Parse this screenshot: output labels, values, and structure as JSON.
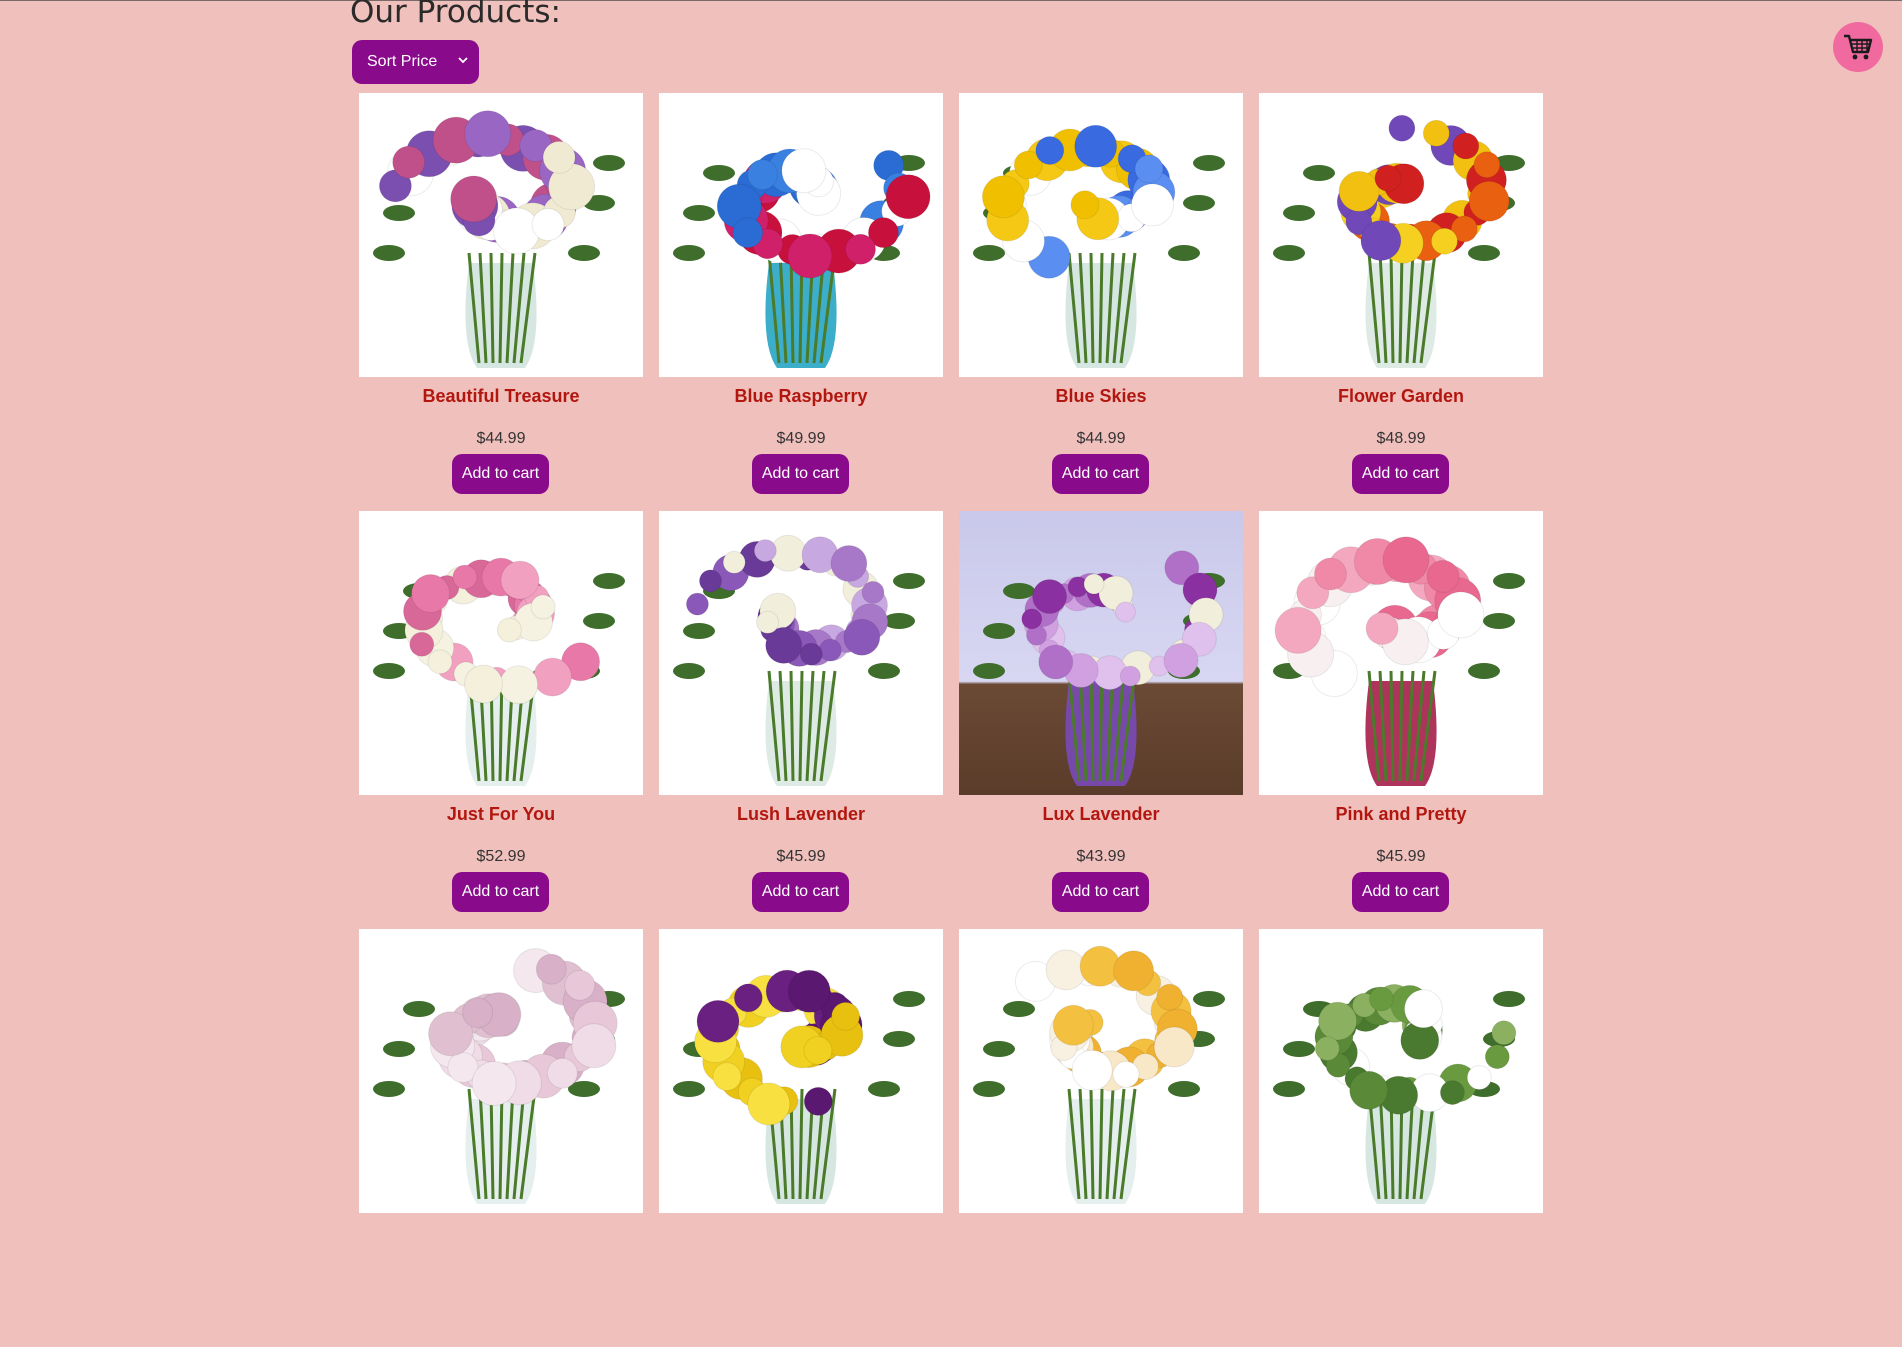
{
  "header": {
    "title": "Our Products:",
    "sort_label": "Sort Price",
    "cart_icon": "shopping-cart-icon",
    "cart_color": "#f06aa0"
  },
  "colors": {
    "background": "#f0c0bd",
    "accent": "#8a0a8c",
    "product_name": "#b2170f"
  },
  "products": [
    {
      "name": "Beautiful Treasure",
      "price": "$44.99",
      "button": "Add to cart",
      "palette": [
        "#9a66c4",
        "#ffffff",
        "#c0508a",
        "#f1ead3",
        "#7b4fb0"
      ]
    },
    {
      "name": "Blue Raspberry",
      "price": "$49.99",
      "button": "Add to cart",
      "palette": [
        "#c8103c",
        "#2a6cd4",
        "#ffffff",
        "#d0206a",
        "#3a80e0"
      ]
    },
    {
      "name": "Blue Skies",
      "price": "$44.99",
      "button": "Add to cart",
      "palette": [
        "#f4c814",
        "#3a6ae0",
        "#ffffff",
        "#f0c000",
        "#5a8ef0"
      ]
    },
    {
      "name": "Flower Garden",
      "price": "$48.99",
      "button": "Add to cart",
      "palette": [
        "#f2c010",
        "#e86010",
        "#7048b8",
        "#d02020",
        "#f5d020"
      ]
    },
    {
      "name": "Just For You",
      "price": "$52.99",
      "button": "Add to cart",
      "palette": [
        "#f2a0c0",
        "#f4f0dc",
        "#e878a8",
        "#f6f2e2",
        "#d86898"
      ]
    },
    {
      "name": "Lush Lavender",
      "price": "$45.99",
      "button": "Add to cart",
      "palette": [
        "#8a58b8",
        "#f2eedc",
        "#a878c8",
        "#6a3a98",
        "#c8a8e0"
      ]
    },
    {
      "name": "Lux Lavender",
      "price": "$43.99",
      "button": "Add to cart",
      "palette": [
        "#b070c8",
        "#f2eedc",
        "#d0a0e0",
        "#8a30a0",
        "#e0c0ec"
      ]
    },
    {
      "name": "Pink and Pretty",
      "price": "$45.99",
      "button": "Add to cart",
      "palette": [
        "#f088a8",
        "#ffffff",
        "#f4a8c0",
        "#e86890",
        "#f8f0f0"
      ]
    },
    {
      "name": "",
      "price": "",
      "button": "",
      "palette": [
        "#e8c8d8",
        "#f4e8ee",
        "#d8b0c8",
        "#f0dce6",
        "#e0c0d0"
      ]
    },
    {
      "name": "",
      "price": "",
      "button": "",
      "palette": [
        "#f0d020",
        "#6a2080",
        "#e8c010",
        "#f8e040",
        "#5a1870"
      ]
    },
    {
      "name": "",
      "price": "",
      "button": "",
      "palette": [
        "#f8f0e0",
        "#f0b030",
        "#ffffff",
        "#f4c040",
        "#f8e8c8"
      ]
    },
    {
      "name": "",
      "price": "",
      "button": "",
      "palette": [
        "#6a9a40",
        "#4a7a30",
        "#8ab060",
        "#ffffff",
        "#5a8a38"
      ]
    }
  ]
}
